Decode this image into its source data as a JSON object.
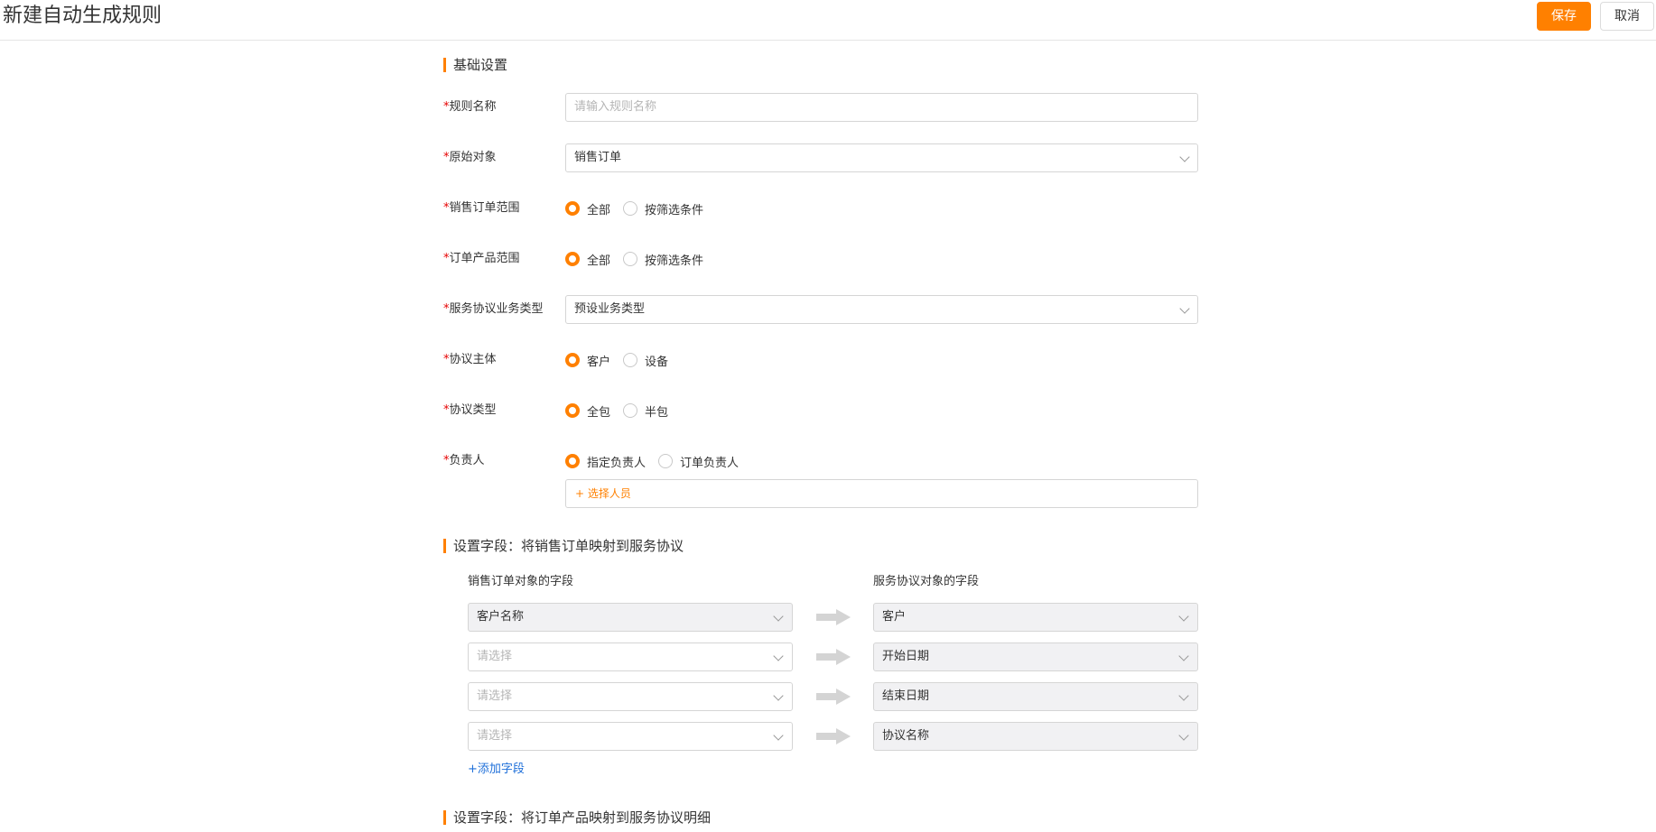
{
  "header": {
    "title": "新建自动生成规则",
    "save_label": "保存",
    "cancel_label": "取消"
  },
  "colors": {
    "accent": "#ff8000",
    "required": "#e60000",
    "link": "#1e6fd9"
  },
  "sections": {
    "basic": "基础设置",
    "map_order": "设置字段：将销售订单映射到服务协议",
    "map_product": "设置字段：将订单产品映射到服务协议明细"
  },
  "form": {
    "required_mark": "*",
    "rule_name": {
      "label": "规则名称",
      "placeholder": "请输入规则名称"
    },
    "source_object": {
      "label": "原始对象",
      "value": "销售订单"
    },
    "order_scope": {
      "label": "销售订单范围",
      "options": [
        "全部",
        "按筛选条件"
      ],
      "selected": "全部"
    },
    "product_scope": {
      "label": "订单产品范围",
      "options": [
        "全部",
        "按筛选条件"
      ],
      "selected": "全部"
    },
    "agreement_business_type": {
      "label": "服务协议业务类型",
      "value": "预设业务类型"
    },
    "agreement_subject": {
      "label": "协议主体",
      "options": [
        "客户",
        "设备"
      ],
      "selected": "客户"
    },
    "agreement_type": {
      "label": "协议类型",
      "options": [
        "全包",
        "半包"
      ],
      "selected": "全包"
    },
    "owner": {
      "label": "负责人",
      "options": [
        "指定负责人",
        "订单负责人"
      ],
      "selected": "指定负责人",
      "select_person": "+ 选择人员"
    }
  },
  "mapping": {
    "left_header": "销售订单对象的字段",
    "right_header": "服务协议对象的字段",
    "rows": [
      {
        "left": "客户名称",
        "left_is_placeholder": false,
        "right": "客户"
      },
      {
        "left": "请选择",
        "left_is_placeholder": true,
        "right": "开始日期"
      },
      {
        "left": "请选择",
        "left_is_placeholder": true,
        "right": "结束日期"
      },
      {
        "left": "请选择",
        "left_is_placeholder": true,
        "right": "协议名称"
      }
    ],
    "add_field": "+添加字段"
  },
  "icons": {
    "dropdown": "chevron-down-icon",
    "map_arrow": "arrow-right-icon"
  }
}
